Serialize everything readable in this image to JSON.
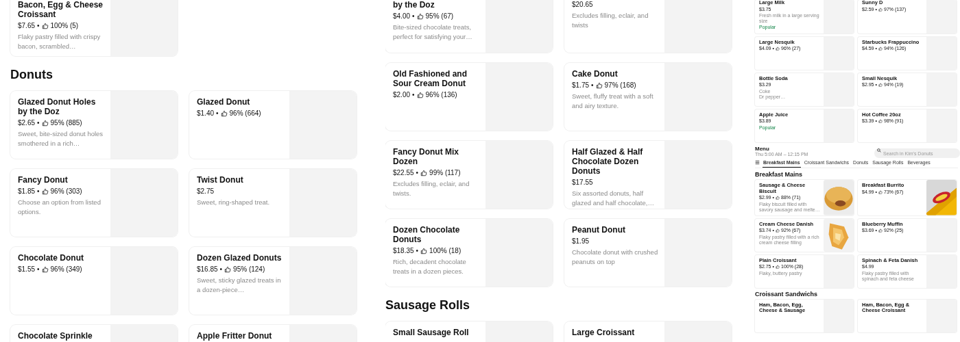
{
  "panels": [
    {
      "sections": [
        {
          "items": [
            {
              "name": "Bacon, Egg & Cheese Croissant",
              "price": "$7.65",
              "dot": "•",
              "rating": "100% (5)",
              "description": "Flaky pastry filled with crispy bacon, scrambled…"
            }
          ]
        },
        {
          "heading": "Donuts",
          "items": [
            {
              "name": "Glazed Donut Holes by the Doz",
              "price": "$2.65",
              "dot": "•",
              "rating": "95% (885)",
              "description": "Sweet, bite-sized donut holes smothered in a rich…"
            },
            {
              "name": "Glazed Donut",
              "price": "$1.40",
              "dot": "•",
              "rating": "96% (664)"
            },
            {
              "name": "Fancy Donut",
              "price": "$1.85",
              "dot": "•",
              "rating": "96% (303)",
              "description": "Choose an option from listed options."
            },
            {
              "name": "Twist Donut",
              "price": "$2.75",
              "description": "Sweet, ring-shaped treat."
            },
            {
              "name": "Chocolate Donut",
              "price": "$1.55",
              "dot": "•",
              "rating": "96% (349)"
            },
            {
              "name": "Dozen Glazed Donuts",
              "price": "$16.85",
              "dot": "•",
              "rating": "95% (124)",
              "description": "Sweet, sticky glazed treats in a dozen-piece…"
            },
            {
              "name": "Chocolate Sprinkle"
            },
            {
              "name": "Apple Fritter Donut"
            }
          ]
        }
      ]
    },
    {
      "sections": [
        {
          "items": [
            {
              "name": "by the Doz",
              "price": "$4.00",
              "dot": "•",
              "rating": "95% (67)",
              "description": "Bite-sized chocolate treats, perfect for satisfying your…"
            },
            {
              "price": "$20.65",
              "description": "Excludes filling, eclair, and twists"
            },
            {
              "name": "Old Fashioned and Sour Cream  Donut",
              "price": "$2.00",
              "dot": "•",
              "rating": "96% (136)"
            },
            {
              "name": "Cake Donut",
              "price": "$1.75",
              "dot": "•",
              "rating": "97% (168)",
              "description": "Sweet, fluffy treat with a soft and airy texture."
            },
            {
              "name": "Fancy Donut Mix Dozen",
              "price": "$22.55",
              "dot": "•",
              "rating": "99% (117)",
              "description": "Excludes filling, eclair, and twists."
            },
            {
              "name": "Half Glazed & Half Chocolate Dozen Donuts",
              "price": "$17.55",
              "description": "Six assorted donuts, half glazed and half chocolate,…"
            },
            {
              "name": "Dozen Chocolate Donuts",
              "price": "$18.35",
              "dot": "•",
              "rating": "100% (18)",
              "description": "Rich, decadent chocolate treats in a dozen pieces."
            },
            {
              "name": "Peanut Donut",
              "price": "$1.95",
              "description": "Chocolate donut with crushed peanuts on top"
            }
          ]
        },
        {
          "heading": "Sausage Rolls",
          "items": [
            {
              "name": "Small Sausage Roll"
            },
            {
              "name": "Large Croissant"
            }
          ]
        }
      ]
    }
  ],
  "preview": {
    "items": [
      {
        "name": "Large Milk",
        "price": "$3.75",
        "description": "Fresh milk in a large serving size",
        "badge": "Popular"
      },
      {
        "name": "Sunny D",
        "price": "$2.59",
        "dot": "•",
        "rating": "97% (137)"
      },
      {
        "name": "Large Nesquik",
        "price": "$4.09",
        "dot": "•",
        "rating": "96% (27)"
      },
      {
        "name": "Starbucks Frappuccino",
        "price": "$4.59",
        "dot": "•",
        "rating": "94% (126)"
      },
      {
        "name": "Bottle Soda",
        "price": "$3.29",
        "description": "Coke\nDr pepper…"
      },
      {
        "name": "Small Nesquik",
        "price": "$2.95",
        "dot": "•",
        "rating": "94% (19)"
      },
      {
        "name": "Apple Juice",
        "price": "$3.89",
        "badge": "Popular"
      },
      {
        "name": "Hot Coffee 20oz",
        "price": "$3.39",
        "dot": "•",
        "rating": "98% (91)"
      }
    ],
    "menu": {
      "title": "Menu",
      "hours": "Thu 5:00 AM – 12:15 PM",
      "search": {
        "placeholder": "Search in Kim's Donuts"
      },
      "tabs": [
        {
          "label": "Breakfast Mains",
          "selected": true
        },
        {
          "label": "Croissant Sandwichs",
          "selected": false
        },
        {
          "label": "Donuts",
          "selected": false
        },
        {
          "label": "Sausage Rolls",
          "selected": false
        },
        {
          "label": "Beverages",
          "selected": false
        }
      ],
      "sections": [
        {
          "heading": "Breakfast Mains",
          "items": [
            {
              "name": "Sausage & Cheese Biscuit",
              "price": "$2.99",
              "dot": "•",
              "rating": "88% (71)",
              "description": "Flaky biscuit filled with savory sausage and melte…",
              "photo": true
            },
            {
              "name": "Breakfast Burrito",
              "price": "$4.99",
              "dot": "•",
              "rating": "73% (67)",
              "photo": true
            },
            {
              "name": "Cream Cheese Danish",
              "price": "$3.74",
              "dot": "•",
              "rating": "92% (67)",
              "description": "Flaky pastry filled with a rich cream cheese filling",
              "photo": true
            },
            {
              "name": "Blueberry Muffin",
              "price": "$3.69",
              "dot": "•",
              "rating": "92% (25)"
            },
            {
              "name": "Plain Croissant",
              "price": "$2.75",
              "dot": "•",
              "rating": "100% (28)",
              "description": "Flaky, buttery pastry"
            },
            {
              "name": "Spinach & Feta Danish",
              "price": "$4.99",
              "description": "Flaky pastry filled with spinach and feta cheese"
            }
          ]
        },
        {
          "heading": "Croissant Sandwichs",
          "items": [
            {
              "name": "Ham, Bacon, Egg, Cheese & Sausage"
            },
            {
              "name": "Ham, Bacon, Egg & Cheese Croissant"
            }
          ]
        }
      ]
    }
  }
}
